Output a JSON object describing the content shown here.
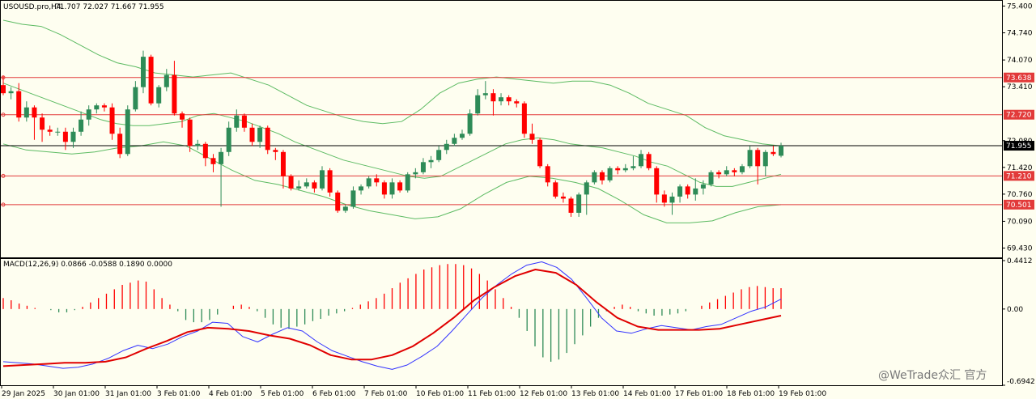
{
  "header": {
    "symbol": "USOUSD.pro,H4",
    "ohlc": "71.707 72.027 71.667 71.955",
    "macd_label": "MACD(12,26,9) 0.0866 -0.0588 0.1890 0.0000"
  },
  "watermark": "@WeTrade众汇 官方",
  "colors": {
    "bg": "#fefef0",
    "bull": "#2e8b57",
    "bear": "#ff0000",
    "band": "#5dbb63",
    "level": "#e23a3a",
    "price_line": "#000000",
    "macd_line": "#3333ff",
    "signal_line": "#e00000"
  },
  "chart_data": [
    {
      "type": "candlestick",
      "title": "USOUSD.pro,H4",
      "x_labels": [
        "29 Jan 2025",
        "30 Jan 01:00",
        "31 Jan 01:00",
        "3 Feb 01:00",
        "4 Feb 01:00",
        "5 Feb 01:00",
        "6 Feb 01:00",
        "7 Feb 01:00",
        "10 Feb 01:00",
        "11 Feb 01:00",
        "12 Feb 01:00",
        "13 Feb 01:00",
        "14 Feb 01:00",
        "17 Feb 01:00",
        "18 Feb 01:00",
        "19 Feb 01:00"
      ],
      "y_ticks": [
        "75.400",
        "74.740",
        "74.070",
        "73.410",
        "72.080",
        "71.420",
        "70.760",
        "70.090",
        "69.430"
      ],
      "ylim": [
        69.2,
        75.55
      ],
      "current_price": {
        "value": 71.955,
        "label": "71.955"
      },
      "levels": [
        {
          "value": 73.638,
          "label": "73.638"
        },
        {
          "value": 72.72,
          "label": "72.720"
        },
        {
          "value": 71.21,
          "label": "71.210"
        },
        {
          "value": 70.501,
          "label": "70.501"
        }
      ],
      "candles": [
        [
          73.45,
          73.25,
          73.68,
          73.2
        ],
        [
          73.25,
          73.3,
          73.4,
          73.1
        ],
        [
          73.3,
          72.65,
          73.5,
          72.55
        ],
        [
          72.65,
          72.9,
          73.05,
          72.55
        ],
        [
          72.9,
          72.65,
          72.95,
          72.1
        ],
        [
          72.65,
          72.35,
          72.75,
          72.05
        ],
        [
          72.35,
          72.3,
          72.45,
          72.2
        ],
        [
          72.3,
          72.3,
          72.4,
          72.2
        ],
        [
          72.3,
          72.05,
          72.4,
          71.85
        ],
        [
          72.05,
          72.3,
          72.4,
          71.9
        ],
        [
          72.3,
          72.6,
          72.8,
          72.2
        ],
        [
          72.6,
          72.85,
          72.95,
          72.45
        ],
        [
          72.85,
          72.95,
          73.0,
          72.75
        ],
        [
          72.95,
          72.9,
          73.0,
          72.8
        ],
        [
          72.9,
          72.25,
          73.0,
          72.1
        ],
        [
          72.25,
          71.75,
          72.4,
          71.65
        ],
        [
          71.75,
          72.85,
          72.95,
          71.7
        ],
        [
          72.85,
          73.4,
          73.55,
          72.8
        ],
        [
          73.4,
          74.15,
          74.3,
          73.25
        ],
        [
          74.15,
          73.0,
          74.2,
          72.95
        ],
        [
          73.0,
          73.4,
          73.45,
          72.9
        ],
        [
          73.4,
          73.7,
          73.85,
          73.3
        ],
        [
          73.7,
          72.75,
          74.05,
          72.7
        ],
        [
          72.75,
          72.6,
          72.8,
          72.4
        ],
        [
          72.6,
          71.95,
          72.65,
          71.8
        ],
        [
          71.95,
          72.0,
          72.1,
          71.85
        ],
        [
          72.0,
          71.65,
          72.05,
          71.45
        ],
        [
          71.65,
          71.5,
          71.75,
          71.3
        ],
        [
          71.5,
          71.8,
          71.9,
          70.45
        ],
        [
          71.8,
          72.4,
          72.55,
          71.7
        ],
        [
          72.4,
          72.7,
          72.85,
          72.3
        ],
        [
          72.7,
          72.4,
          72.75,
          72.3
        ],
        [
          72.4,
          72.05,
          72.5,
          71.95
        ],
        [
          72.05,
          72.4,
          72.45,
          71.9
        ],
        [
          72.4,
          71.85,
          72.45,
          71.75
        ],
        [
          71.85,
          71.8,
          71.9,
          71.6
        ],
        [
          71.8,
          71.2,
          71.85,
          70.9
        ],
        [
          71.2,
          70.9,
          71.25,
          70.85
        ],
        [
          70.9,
          70.95,
          71.1,
          70.85
        ],
        [
          70.95,
          71.05,
          71.15,
          70.9
        ],
        [
          71.05,
          70.9,
          71.1,
          70.8
        ],
        [
          70.9,
          71.35,
          71.45,
          70.85
        ],
        [
          71.35,
          70.8,
          71.4,
          70.7
        ],
        [
          70.8,
          70.35,
          70.85,
          70.3
        ],
        [
          70.35,
          70.45,
          70.5,
          70.3
        ],
        [
          70.45,
          70.85,
          70.95,
          70.4
        ],
        [
          70.85,
          70.95,
          71.0,
          70.75
        ],
        [
          70.95,
          71.15,
          71.2,
          70.9
        ],
        [
          71.15,
          71.05,
          71.25,
          70.95
        ],
        [
          71.05,
          70.75,
          71.1,
          70.65
        ],
        [
          70.75,
          71.05,
          71.15,
          70.65
        ],
        [
          71.05,
          70.85,
          71.1,
          70.8
        ],
        [
          70.85,
          71.25,
          71.3,
          70.8
        ],
        [
          71.25,
          71.3,
          71.4,
          71.15
        ],
        [
          71.3,
          71.55,
          71.65,
          71.25
        ],
        [
          71.55,
          71.6,
          71.7,
          71.4
        ],
        [
          71.6,
          71.85,
          71.95,
          71.55
        ],
        [
          71.85,
          72.0,
          72.1,
          71.75
        ],
        [
          72.0,
          72.15,
          72.25,
          71.95
        ],
        [
          72.15,
          72.25,
          72.35,
          72.1
        ],
        [
          72.25,
          72.75,
          72.85,
          72.2
        ],
        [
          72.75,
          73.2,
          73.35,
          72.7
        ],
        [
          73.2,
          73.25,
          73.55,
          73.1
        ],
        [
          73.25,
          73.05,
          73.35,
          72.7
        ],
        [
          73.05,
          73.15,
          73.25,
          72.95
        ],
        [
          73.15,
          73.05,
          73.2,
          72.95
        ],
        [
          73.05,
          73.0,
          73.1,
          72.9
        ],
        [
          73.0,
          72.25,
          73.05,
          72.15
        ],
        [
          72.25,
          72.1,
          72.5,
          72.0
        ],
        [
          72.1,
          71.45,
          72.15,
          71.4
        ],
        [
          71.45,
          71.05,
          71.5,
          70.95
        ],
        [
          71.05,
          70.7,
          71.1,
          70.65
        ],
        [
          70.7,
          70.65,
          70.8,
          70.55
        ],
        [
          70.65,
          70.3,
          70.7,
          70.2
        ],
        [
          70.3,
          70.75,
          70.8,
          70.2
        ],
        [
          70.75,
          71.05,
          71.1,
          70.25
        ],
        [
          71.05,
          71.3,
          71.35,
          71.0
        ],
        [
          71.3,
          71.1,
          71.35,
          71.0
        ],
        [
          71.1,
          71.4,
          71.45,
          71.05
        ],
        [
          71.4,
          71.35,
          71.45,
          71.25
        ],
        [
          71.35,
          71.4,
          71.5,
          71.3
        ],
        [
          71.4,
          71.45,
          71.7,
          71.35
        ],
        [
          71.45,
          71.75,
          71.85,
          71.4
        ],
        [
          71.75,
          71.4,
          71.8,
          71.35
        ],
        [
          71.4,
          70.75,
          71.45,
          70.55
        ],
        [
          70.75,
          70.55,
          70.85,
          70.45
        ],
        [
          70.55,
          70.7,
          70.8,
          70.25
        ],
        [
          70.7,
          70.95,
          71.0,
          70.55
        ],
        [
          70.95,
          70.75,
          71.0,
          70.65
        ],
        [
          70.75,
          70.9,
          71.15,
          70.6
        ],
        [
          70.9,
          71.0,
          71.1,
          70.75
        ],
        [
          71.0,
          71.3,
          71.35,
          70.95
        ],
        [
          71.3,
          71.25,
          71.35,
          71.15
        ],
        [
          71.25,
          71.35,
          71.45,
          71.2
        ],
        [
          71.35,
          71.3,
          71.4,
          71.2
        ],
        [
          71.3,
          71.45,
          71.5,
          71.25
        ],
        [
          71.45,
          71.85,
          71.95,
          71.4
        ],
        [
          71.85,
          71.45,
          71.9,
          71.0
        ],
        [
          71.45,
          71.8,
          71.85,
          71.2
        ],
        [
          71.8,
          71.75,
          71.95,
          71.7
        ],
        [
          71.707,
          71.955,
          72.027,
          71.667
        ]
      ],
      "bollinger_upper": [
        75.05,
        74.95,
        74.9,
        74.7,
        74.45,
        74.2,
        74.0,
        73.9,
        73.75,
        73.7,
        73.65,
        73.7,
        73.75,
        73.6,
        73.45,
        73.2,
        72.95,
        72.8,
        72.65,
        72.55,
        72.5,
        72.55,
        72.85,
        73.25,
        73.5,
        73.6,
        73.65,
        73.6,
        73.55,
        73.5,
        73.55,
        73.55,
        73.45,
        73.25,
        73.0,
        72.85,
        72.7,
        72.4,
        72.2,
        72.1,
        72.0,
        71.95
      ],
      "bollinger_mid": [
        73.5,
        73.35,
        73.2,
        73.05,
        72.9,
        72.75,
        72.6,
        72.5,
        72.45,
        72.45,
        72.5,
        72.55,
        72.7,
        72.75,
        72.65,
        72.55,
        72.4,
        72.25,
        72.05,
        71.9,
        71.75,
        71.6,
        71.5,
        71.4,
        71.3,
        71.2,
        71.15,
        71.2,
        71.4,
        71.6,
        71.8,
        72.0,
        72.1,
        72.15,
        72.1,
        72.0,
        71.95,
        71.9,
        71.8,
        71.7,
        71.55,
        71.45,
        71.25,
        71.05,
        70.95,
        70.95,
        71.05,
        71.15,
        71.25
      ],
      "bollinger_lower": [
        72.0,
        71.85,
        71.8,
        71.75,
        71.8,
        71.9,
        71.95,
        72.05,
        71.95,
        71.65,
        71.35,
        71.1,
        71.0,
        70.85,
        70.7,
        70.5,
        70.35,
        70.25,
        70.15,
        70.2,
        70.4,
        70.75,
        71.05,
        71.2,
        71.15,
        71.05,
        70.9,
        70.6,
        70.25,
        70.05,
        70.05,
        70.1,
        70.3,
        70.45,
        70.5
      ],
      "bollinger_anchor_days": [
        "29 Jan 2025",
        "19 Feb 01:00"
      ]
    },
    {
      "type": "macd",
      "title": "MACD(12,26,9)",
      "params": [
        12,
        26,
        9
      ],
      "values": {
        "macd": 0.0866,
        "signal": -0.0588,
        "osma": 0.189,
        "zero": 0.0
      },
      "y_ticks": [
        "0.4412",
        "0.00",
        "-0.6942"
      ],
      "ylim": [
        -0.6942,
        0.4412
      ],
      "histogram": [
        0.1,
        0.08,
        0.05,
        0.03,
        0.01,
        0.0,
        -0.01,
        -0.03,
        -0.03,
        -0.01,
        0.02,
        0.06,
        0.1,
        0.14,
        0.18,
        0.22,
        0.24,
        0.26,
        0.25,
        0.18,
        0.1,
        0.04,
        -0.02,
        -0.1,
        -0.12,
        -0.12,
        -0.1,
        -0.05,
        0.0,
        0.03,
        0.04,
        0.02,
        -0.02,
        -0.08,
        -0.14,
        -0.17,
        -0.18,
        -0.16,
        -0.14,
        -0.11,
        -0.09,
        -0.06,
        -0.04,
        -0.02,
        0.01,
        0.04,
        0.07,
        0.1,
        0.14,
        0.19,
        0.24,
        0.28,
        0.32,
        0.36,
        0.38,
        0.4,
        0.41,
        0.41,
        0.4,
        0.37,
        0.32,
        0.26,
        0.18,
        0.1,
        0.02,
        -0.08,
        -0.2,
        -0.34,
        -0.44,
        -0.48,
        -0.46,
        -0.4,
        -0.32,
        -0.24,
        -0.16,
        -0.08,
        -0.02,
        0.02,
        0.04,
        0.02,
        -0.02,
        -0.04,
        -0.06,
        -0.06,
        -0.05,
        -0.04,
        -0.02,
        0.0,
        0.03,
        0.06,
        0.09,
        0.12,
        0.15,
        0.18,
        0.2,
        0.21,
        0.2,
        0.19,
        0.19
      ],
      "macd_line": [
        -0.48,
        -0.49,
        -0.5,
        -0.52,
        -0.54,
        -0.53,
        -0.5,
        -0.45,
        -0.38,
        -0.33,
        -0.36,
        -0.32,
        -0.25,
        -0.2,
        -0.12,
        -0.13,
        -0.25,
        -0.3,
        -0.23,
        -0.17,
        -0.2,
        -0.3,
        -0.38,
        -0.43,
        -0.48,
        -0.52,
        -0.55,
        -0.51,
        -0.43,
        -0.34,
        -0.2,
        -0.05,
        0.1,
        0.22,
        0.32,
        0.4,
        0.43,
        0.38,
        0.27,
        0.1,
        -0.08,
        -0.2,
        -0.22,
        -0.18,
        -0.15,
        -0.17,
        -0.19,
        -0.16,
        -0.14,
        -0.08,
        -0.02,
        0.02,
        0.09
      ],
      "signal_line": [
        -0.52,
        -0.51,
        -0.5,
        -0.49,
        -0.49,
        -0.48,
        -0.44,
        -0.36,
        -0.29,
        -0.21,
        -0.17,
        -0.18,
        -0.2,
        -0.24,
        -0.27,
        -0.33,
        -0.42,
        -0.46,
        -0.46,
        -0.42,
        -0.34,
        -0.22,
        -0.08,
        0.08,
        0.2,
        0.3,
        0.36,
        0.33,
        0.22,
        0.06,
        -0.08,
        -0.16,
        -0.19,
        -0.19,
        -0.19,
        -0.18,
        -0.14,
        -0.1,
        -0.06
      ]
    }
  ]
}
